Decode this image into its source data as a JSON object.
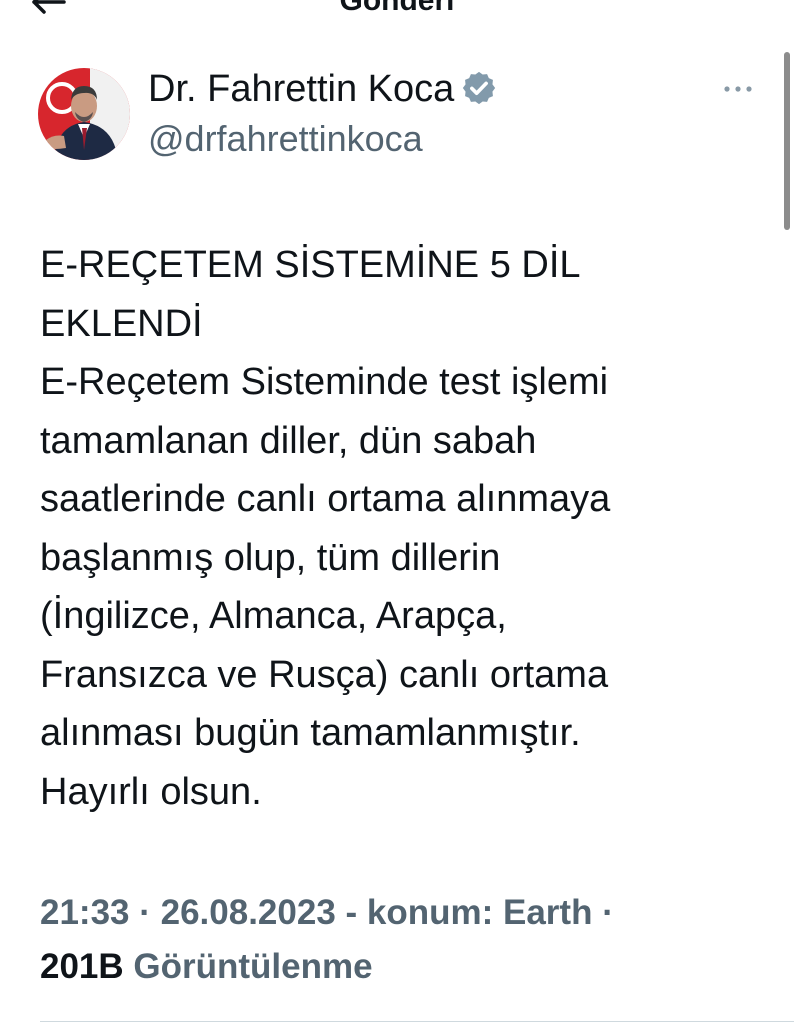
{
  "header": {
    "title": "Gönderi",
    "back_icon": "arrow-left-icon"
  },
  "tweet": {
    "author": {
      "name": "Dr. Fahrettin Koca",
      "handle": "@drfahrettinkoca",
      "verified": true,
      "verified_icon": "verified-badge-icon",
      "avatar": "avatar-photo"
    },
    "more_icon": "more-options-icon",
    "text": "E-REÇETEM SİSTEMİNE 5 DİL\nEKLENDİ\nE-Reçetem Sisteminde test işlemi\ntamamlanan diller, dün sabah\nsaatlerinde canlı ortama alınmaya\nbaşlanmış olup, tüm dillerin\n(İngilizce, Almanca, Arapça,\nFransızca ve Rusça) canlı ortama\nalınması bugün tamamlanmıştır.\nHayırlı olsun.",
    "meta": "21:33 · 26.08.2023 - konum: Earth ·",
    "views_count": "201B",
    "views_label": "Görüntülenme"
  },
  "colors": {
    "text_primary": "#0f1419",
    "text_secondary": "#536471",
    "verified": "#829aab",
    "divider": "#cfd9de"
  }
}
